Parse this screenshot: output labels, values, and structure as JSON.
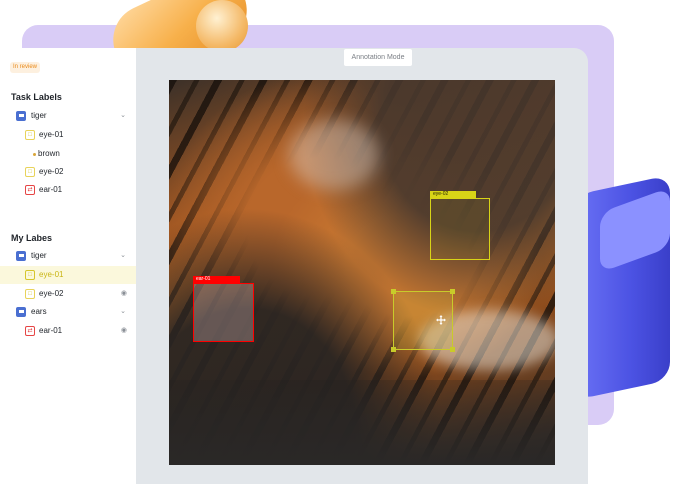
{
  "status_badge": "In review",
  "mode_label": "Annotation Mode",
  "task_labels": {
    "title": "Task Labels",
    "items": [
      {
        "label": "tiger",
        "icon": "tag-icon",
        "color": "#4a6fd1"
      },
      {
        "label": "eye-01",
        "icon": "eye-box-icon",
        "color": "#e8d35a"
      },
      {
        "label": "brown",
        "icon": "bullet-icon",
        "color": "#d9a53a"
      },
      {
        "label": "eye-02",
        "icon": "eye-box-icon",
        "color": "#e8d35a"
      },
      {
        "label": "ear-01",
        "icon": "ear-box-icon",
        "color": "#e64545"
      }
    ]
  },
  "my_labels": {
    "title": "My Labes",
    "items": [
      {
        "label": "tiger",
        "icon": "tag-icon",
        "color": "#4a6fd1"
      },
      {
        "label": "eye-01",
        "icon": "eye-box-icon",
        "color": "#d6c62b"
      },
      {
        "label": "eye-02",
        "icon": "eye-box-icon",
        "color": "#e8d35a"
      },
      {
        "label": "ears",
        "icon": "tag-icon",
        "color": "#4a6fd1"
      },
      {
        "label": "ear-01",
        "icon": "ear-box-icon",
        "color": "#e64545"
      }
    ]
  },
  "annotations": [
    {
      "label": "eye-02",
      "color": "#d8d417"
    },
    {
      "label": "ear-01",
      "color": "#ff0000"
    },
    {
      "label": "",
      "color": "#c9cb2a"
    }
  ],
  "colors": {
    "accent_yellow": "#d8d417",
    "accent_red": "#ff0000",
    "highlight_row": "#fbf8dc"
  }
}
